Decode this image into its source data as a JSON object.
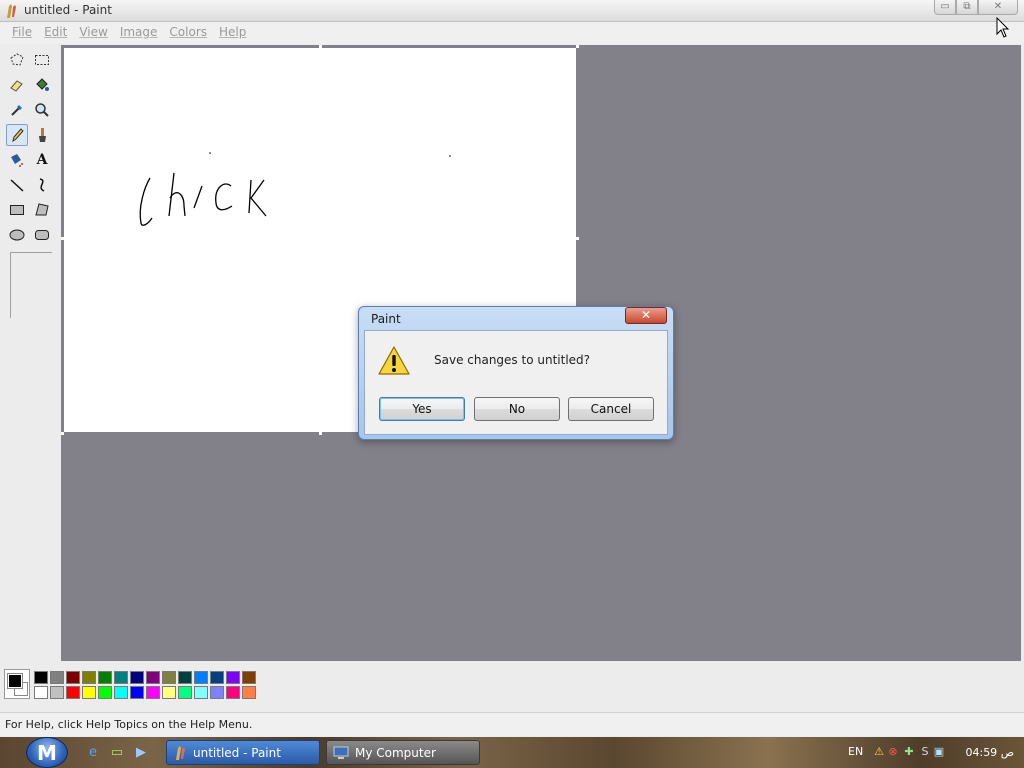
{
  "window": {
    "title": "untitled - Paint",
    "minimize": "▭",
    "restore": "⧉",
    "close": "✕"
  },
  "menu": [
    "File",
    "Edit",
    "View",
    "Image",
    "Colors",
    "Help"
  ],
  "canvas": {
    "drawn_text": "Chick"
  },
  "status": {
    "text": "For Help, click Help Topics on the Help Menu."
  },
  "palette": {
    "foreground": "#000000",
    "background": "#ffffff",
    "colors": [
      "#000000",
      "#808080",
      "#800000",
      "#808000",
      "#008000",
      "#008080",
      "#000080",
      "#800080",
      "#808040",
      "#004040",
      "#0080ff",
      "#004080",
      "#8000ff",
      "#804000",
      "#ffffff",
      "#c0c0c0",
      "#ff0000",
      "#ffff00",
      "#00ff00",
      "#00ffff",
      "#0000ff",
      "#ff00ff",
      "#ffff80",
      "#00ff80",
      "#80ffff",
      "#8080ff",
      "#ff0080",
      "#ff8040"
    ]
  },
  "dialog": {
    "title": "Paint",
    "close": "✕",
    "message": "Save changes to untitled?",
    "buttons": {
      "yes": "Yes",
      "no": "No",
      "cancel": "Cancel"
    }
  },
  "taskbar": {
    "start": "M",
    "tasks": [
      {
        "label": "untitled - Paint",
        "active": true
      },
      {
        "label": "My Computer",
        "active": false
      }
    ],
    "tray": {
      "lang": "EN",
      "clock": "04:59 ص"
    }
  }
}
